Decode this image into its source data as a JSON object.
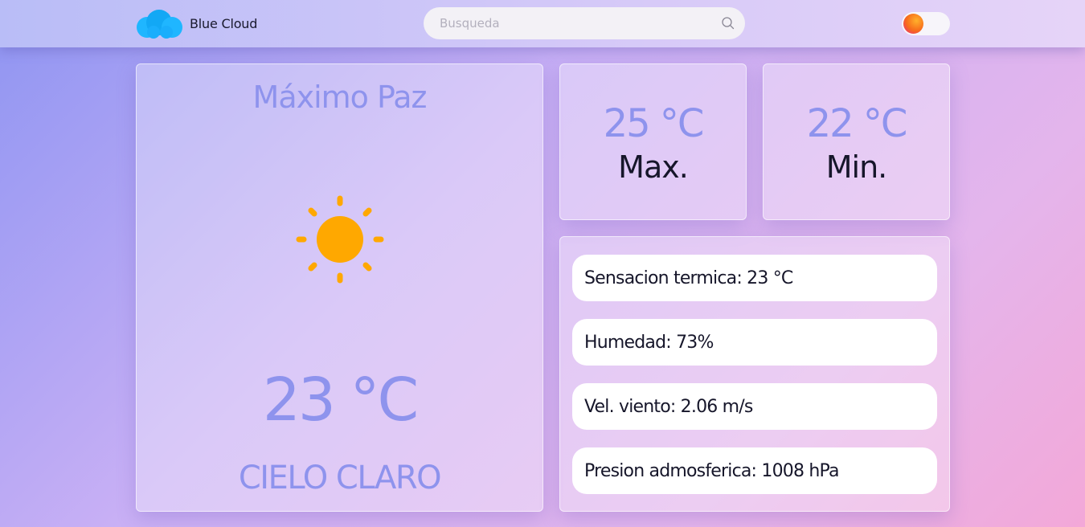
{
  "header": {
    "brand": "Blue Cloud",
    "logo_icon": "cloud-logo-icon",
    "search": {
      "placeholder": "Busqueda",
      "value": "",
      "icon": "search-icon"
    },
    "theme_toggle": {
      "icon": "theme-toggle",
      "state": "off"
    }
  },
  "weather": {
    "city": "Máximo Paz",
    "icon": "sun-icon",
    "temperature": "23 °C",
    "description": "CIELO CLARO",
    "max": {
      "value": "25 °C",
      "label": "Max."
    },
    "min": {
      "value": "22 °C",
      "label": "Min."
    },
    "details": [
      {
        "text": "Sensacion termica: 23 °C"
      },
      {
        "text": "Humedad: 73%"
      },
      {
        "text": "Vel. viento: 2.06 m/s"
      },
      {
        "text": "Presion admosferica: 1008 hPa"
      }
    ]
  },
  "colors": {
    "accent": "#8e93ed",
    "sun": "#ffa800",
    "logo": "#1fb6ff",
    "text_dark": "#16162a"
  }
}
